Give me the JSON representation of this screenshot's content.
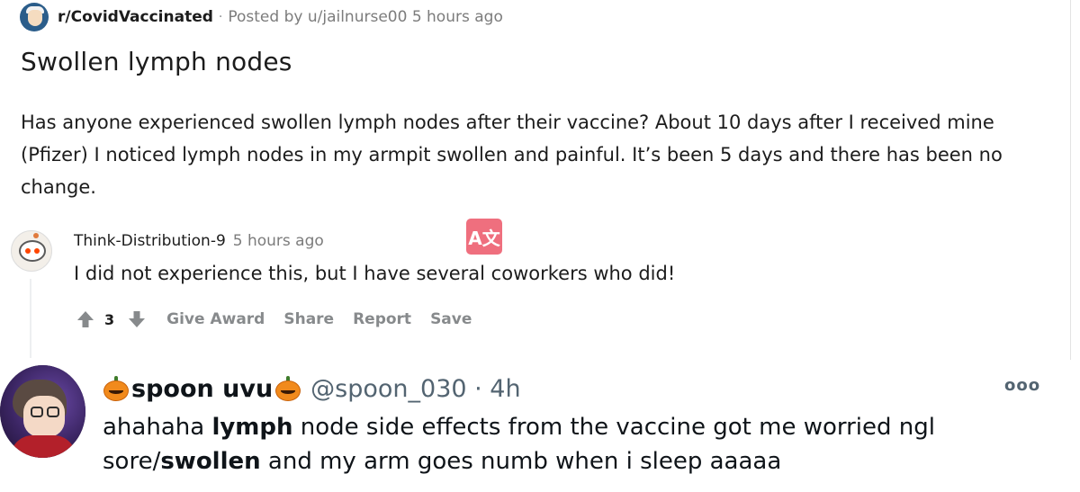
{
  "post": {
    "subreddit": "r/CovidVaccinated",
    "separator": "·",
    "posted_by": "Posted by u/jailnurse00 5 hours ago",
    "title": "Swollen lymph nodes",
    "body": "Has anyone experienced swollen lymph nodes after their vaccine? About 10 days after I received mine (Pfizer) I noticed lymph nodes in my armpit swollen and painful. It’s been 5 days and there has been no change."
  },
  "comment": {
    "author": "Think-Distribution-9",
    "time": "5 hours ago",
    "text": "I did not experience this, but I have several coworkers who did!",
    "translate_badge": "A文",
    "vote_count": "3",
    "actions": {
      "give_award": "Give Award",
      "share": "Share",
      "report": "Report",
      "save": "Save"
    }
  },
  "tweet": {
    "display_name": "spoon uvu",
    "handle_time": "@spoon_030 · 4h",
    "more": "ooo",
    "text_part1": "ahahaha ",
    "text_bold1": "lymph",
    "text_part2": " node side effects from the vaccine got me worried ngl sore/",
    "text_bold2": "swollen",
    "text_part3": " and my arm goes numb when i sleep aaaaa"
  },
  "icons": {
    "upvote": "arrow-up-icon",
    "downvote": "arrow-down-icon",
    "pumpkin": "jack-o-lantern-icon"
  },
  "colors": {
    "meta_gray": "#7c7c7c",
    "action_gray": "#878a8c",
    "translate_badge": "#ef6f7e",
    "handle_gray": "#536471"
  }
}
